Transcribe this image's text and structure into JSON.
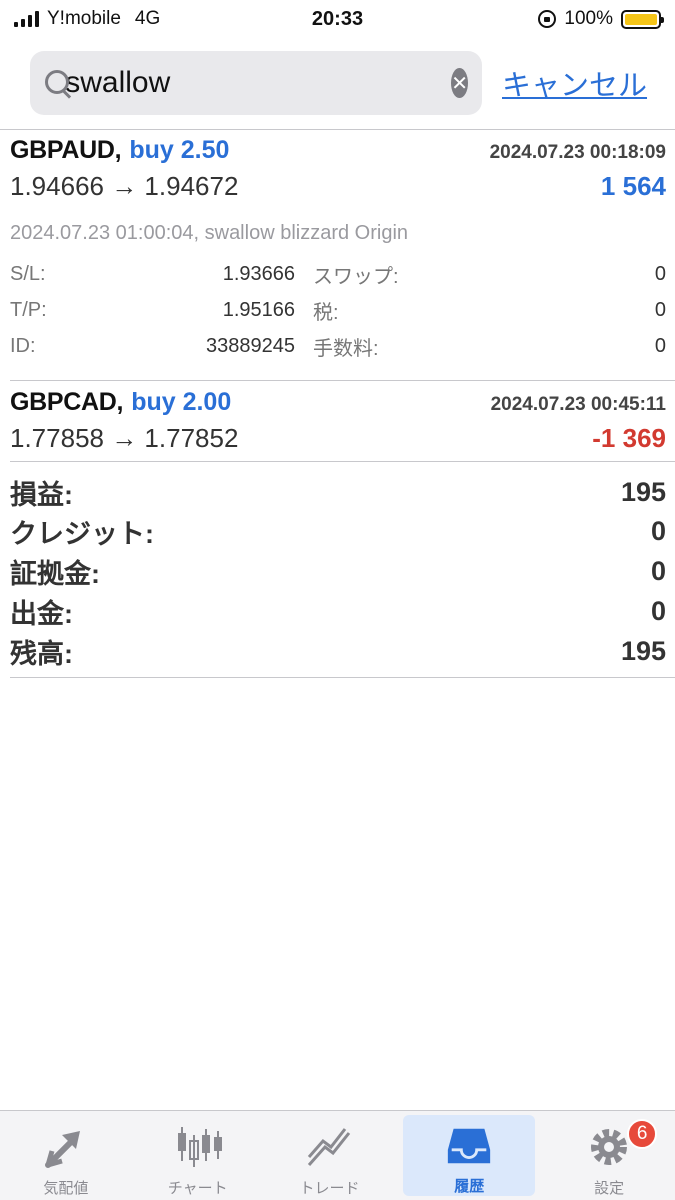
{
  "status_bar": {
    "carrier": "Y!mobile",
    "network": "4G",
    "time": "20:33",
    "battery": "100%",
    "battery_level": 1.0
  },
  "search": {
    "query": "swallow",
    "cancel_label": "キャンセル"
  },
  "trades": [
    {
      "symbol": "GBPAUD,",
      "type": "buy 2.50",
      "time": "2024.07.23 00:18:09",
      "prices": "1.94666 → 1.94672",
      "profit": "1 564",
      "comment": "2024.07.23 01:00:04, swallow blizzard Origin",
      "details": [
        {
          "label": "S/L:",
          "value": "1.93666",
          "label2": "スワップ:",
          "value2": "0"
        },
        {
          "label": "T/P:",
          "value": "1.95166",
          "label2": "税:",
          "value2": "0"
        },
        {
          "label": "ID:",
          "value": "33889245",
          "label2": "手数料:",
          "value2": "0"
        }
      ]
    },
    {
      "symbol": "GBPCAD,",
      "type": "buy 2.00",
      "time": "2024.07.23 00:45:11",
      "prices": "1.77858 → 1.77852",
      "profit": "-1 369"
    }
  ],
  "summary": [
    {
      "label": "損益:",
      "value": "195"
    },
    {
      "label": "クレジット:",
      "value": "0"
    },
    {
      "label": "証拠金:",
      "value": "0"
    },
    {
      "label": "出金:",
      "value": "0"
    },
    {
      "label": "残高:",
      "value": "195"
    }
  ],
  "tabs": [
    {
      "label": "気配値",
      "icon": "quotes-icon"
    },
    {
      "label": "チャート",
      "icon": "chart-icon"
    },
    {
      "label": "トレード",
      "icon": "trade-icon"
    },
    {
      "label": "履歴",
      "icon": "history-icon",
      "active": true
    },
    {
      "label": "設定",
      "icon": "settings-icon",
      "badge": "6"
    }
  ],
  "colors": {
    "accent": "#2a6fd6",
    "loss": "#d23a30",
    "badge": "#e74a3b"
  }
}
